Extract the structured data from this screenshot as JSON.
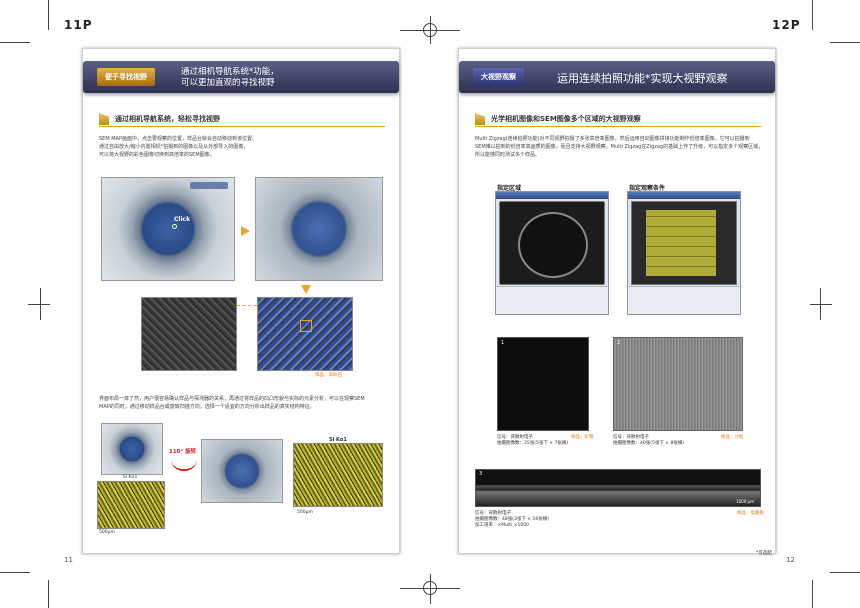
{
  "folio": {
    "left": "11P",
    "right": "12P"
  },
  "page_numbers": {
    "left": "11",
    "right": "12"
  },
  "left": {
    "tag": "便于寻找视野",
    "title_line1": "通过相机导航系统*功能，",
    "title_line2": "可以更加直观的寻找视野",
    "subheading": "通过相机导航系统，轻松寻找视野",
    "para1": [
      "SEM MAP画面中，点击要观察的位置，样品台就会自动移动到该位置。",
      "通过自由放大/缩小内置相机*拍摄到的图像以及从外部导入的图像，",
      "可以将大视野的彩色图像切换到高倍率的SEM图像。"
    ],
    "click_label": "Click",
    "sample_label_1": "样品：高岭石",
    "para2": [
      "界面布局一目了然，用户很容易确认样品与探测器的关系，再通过将样品的凹凸形貌与实际的元素分析，可以在观察SEM",
      "MAP的同时，通过移动样品台或旋转扫描方向，选择一个适宜的方向分析出样品的真实结构特征。"
    ],
    "rotation_label": "110° 旋转",
    "map_label": "Si Kα1",
    "scale_small": "500μm",
    "scale_small_2": "500μm"
  },
  "right": {
    "tag": "大视野观察",
    "title": "运用连续拍照功能*实现大视野观察",
    "subheading": "光学相机图像和SEM图像多个区域的大视野观察",
    "para1": [
      "Multi Zigzag(连续拍照功能)对不同视野拍摄了多张高倍率图像，然后运用自动图像拼接功能制作低倍率图像。它可以拍摄到",
      "SEM难以拍到的低倍率高画质的图像，而且支持大视野观察。Multi Zigzag在Zigzag的基础上作了升级，可以指定多个观察区域，",
      "所以能够同时测试多个样品。"
    ],
    "label_area": "指定区域",
    "label_condition": "指定观察条件",
    "window_title": "Zigzag image select mode",
    "caption1": [
      "信号：背散射电子",
      "拍摄图像数：35张(5张下 × 7张横)"
    ],
    "sample1": "样品：矿物",
    "caption2": [
      "信号：背散射电子",
      "拍摄图像数：40张(5张下 × 8张横)"
    ],
    "sample2": "样品：沙粒",
    "caption3": [
      "信号：背散射电子",
      "拍摄图像数：48张(3张下 × 16张横)",
      "加工倍率：×Multi ×1000"
    ],
    "sample3": "样品：电路板",
    "scale_strip": "1000 μm",
    "footnote": "*可选配",
    "num1": "1",
    "num2": "2",
    "num3": "3"
  }
}
